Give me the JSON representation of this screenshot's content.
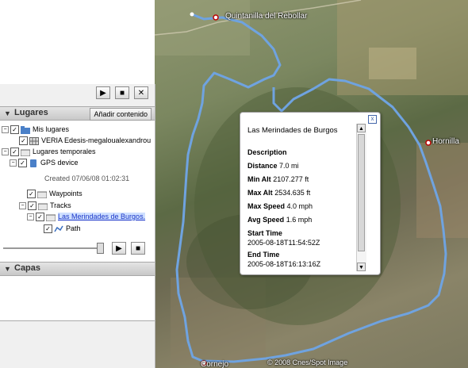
{
  "map": {
    "labels": {
      "quintanilla": "Quintanilla del Rebollar",
      "hornilla": "Hornilla",
      "cornejo": "Cornejo",
      "copyright": "© 2008 Cnes/Spot Image"
    }
  },
  "panel": {
    "toolbar": {
      "play": "▶",
      "stop": "■",
      "close": "✕"
    },
    "lugares": {
      "title": "Lugares",
      "add_button": "Añadir contenido"
    },
    "tree": {
      "mis_lugares": "Mis lugares",
      "veria": "VERIA Edesis-megaloualexandrou",
      "lugares_temporales": "Lugares temporales",
      "gps_device": "GPS device",
      "created": "Created 07/06/08 01:02:31",
      "waypoints": "Waypoints",
      "tracks": "Tracks",
      "track_name": "Las Merindades de Burgos.",
      "path": "Path"
    },
    "capas": {
      "title": "Capas"
    }
  },
  "balloon": {
    "title": "Las Merindades de Burgos",
    "description_label": "Description",
    "distance_label": "Distance",
    "distance_value": "7.0 mi",
    "min_alt_label": "Min Alt",
    "min_alt_value": "2107.277 ft",
    "max_alt_label": "Max Alt",
    "max_alt_value": "2534.635 ft",
    "max_speed_label": "Max Speed",
    "max_speed_value": "4.0 mph",
    "avg_speed_label": "Avg Speed",
    "avg_speed_value": "1.6 mph",
    "start_time_label": "Start Time",
    "start_time_value": "2005-08-18T11:54:52Z",
    "end_time_label": "End Time",
    "end_time_value": "2005-08-18T16:13:16Z",
    "close_icon": "x"
  },
  "colors": {
    "track": "#6fa3e0",
    "accent_link": "#1a35c8"
  }
}
